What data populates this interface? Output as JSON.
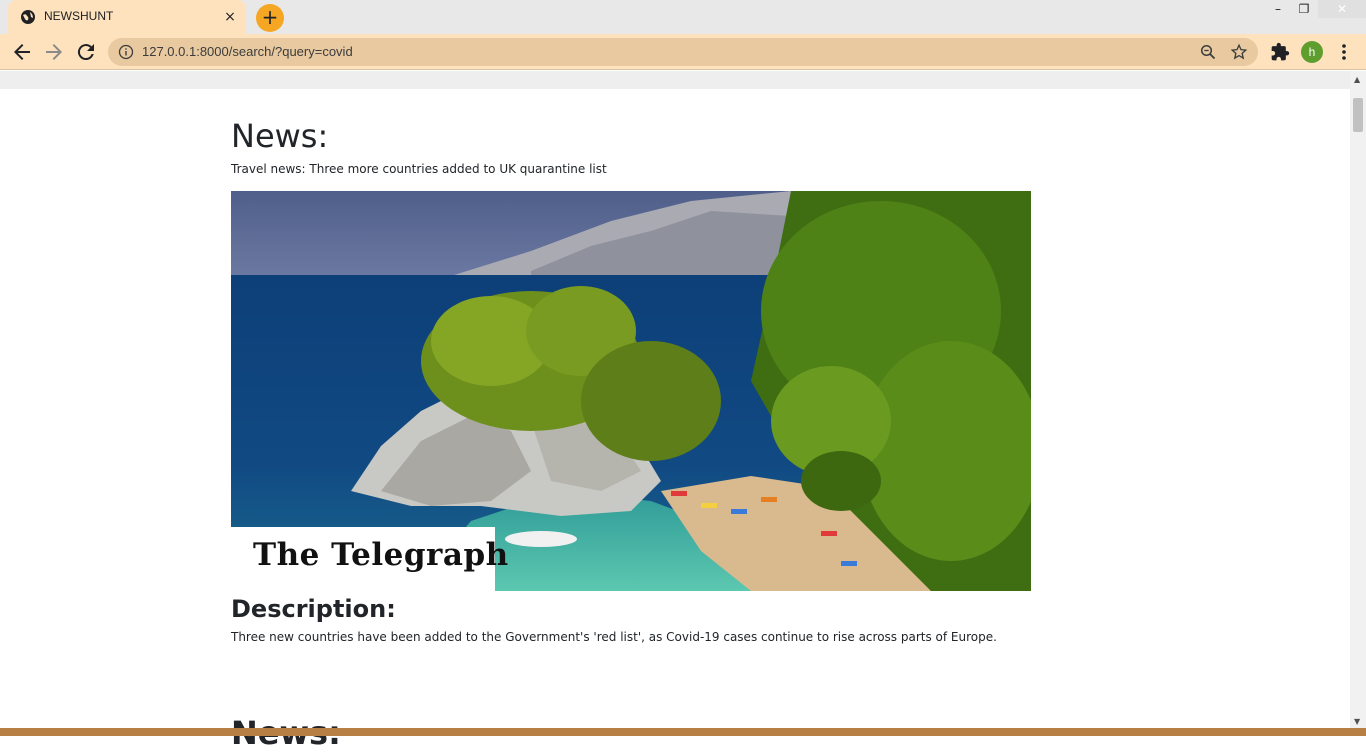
{
  "browser": {
    "tab_title": "NEWSHUNT",
    "tab_close_glyph": "×",
    "new_tab_glyph": "+",
    "url": "127.0.0.1:8000/search/?query=covid",
    "profile_initial": "h",
    "window_controls": {
      "minimize": "–",
      "maximize": "❐",
      "close": "✕"
    },
    "colors": {
      "toolbar": "#fde2bd",
      "omnibox": "#e8c9a0",
      "new_tab": "#f5a623",
      "profile": "#5e9e2e"
    },
    "icons": [
      "globe-icon",
      "back-icon",
      "forward-icon",
      "reload-icon",
      "info-icon",
      "zoom-icon",
      "star-icon",
      "puzzle-icon",
      "menu-icon"
    ]
  },
  "article": {
    "heading": "News:",
    "title": "Travel news: Three more countries added to UK quarantine list",
    "image_logo": "The Telegraph",
    "description_heading": "Description:",
    "description": "Three new countries have been added to the Government's 'red list', as Covid-19 cases continue to rise across parts of Europe."
  },
  "next_article": {
    "heading": "News:"
  }
}
